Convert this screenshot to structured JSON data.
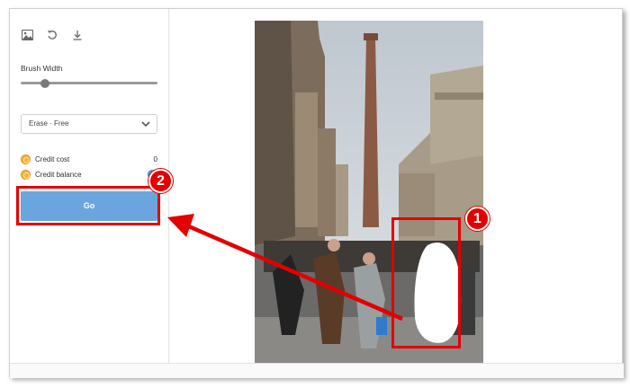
{
  "sidebar": {
    "toolbar": {
      "icons": [
        "image-icon",
        "undo-icon",
        "download-icon"
      ]
    },
    "brush": {
      "label": "Brush Width",
      "value_fraction": 0.18
    },
    "mode_select": {
      "value": "Erase · Free"
    },
    "credits": {
      "cost_label": "Credit cost",
      "cost_value": "0",
      "balance_label": "Credit balance"
    },
    "go_label": "Go"
  },
  "annotations": {
    "badge_1": "1",
    "badge_2": "2",
    "highlight_color": "#e30000"
  },
  "colors": {
    "go_button": "#6aa6dd",
    "accent": "#3f8fd6",
    "coin": "#f3b332"
  }
}
